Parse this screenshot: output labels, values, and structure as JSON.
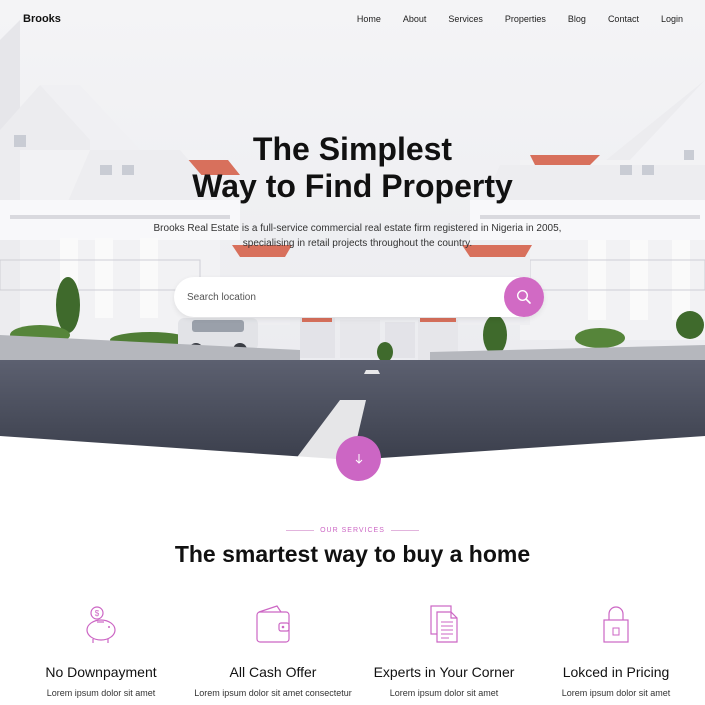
{
  "brand": "Brooks",
  "nav": {
    "items": [
      "Home",
      "About",
      "Services",
      "Properties",
      "Blog",
      "Contact",
      "Login"
    ]
  },
  "hero": {
    "title_line1": "The Simplest",
    "title_line2": "Way to Find Property",
    "subtitle": "Brooks Real Estate is a full-service commercial real estate firm registered in Nigeria in 2005, specialising in retail projects throughout the country.",
    "search_placeholder": "Search location"
  },
  "services": {
    "eyebrow": "OUR SERVICES",
    "title": "The smartest way to buy a home",
    "features": [
      {
        "icon": "piggy-bank-icon",
        "title": "No Downpayment",
        "desc": "Lorem ipsum dolor sit amet"
      },
      {
        "icon": "wallet-icon",
        "title": "All Cash Offer",
        "desc": "Lorem ipsum dolor sit amet consectetur"
      },
      {
        "icon": "documents-icon",
        "title": "Experts in Your Corner",
        "desc": "Lorem ipsum dolor sit amet"
      },
      {
        "icon": "lock-icon",
        "title": "Lokced in Pricing",
        "desc": "Lorem ipsum dolor sit amet"
      }
    ]
  },
  "colors": {
    "accent": "#cc66c4",
    "text": "#111111"
  }
}
